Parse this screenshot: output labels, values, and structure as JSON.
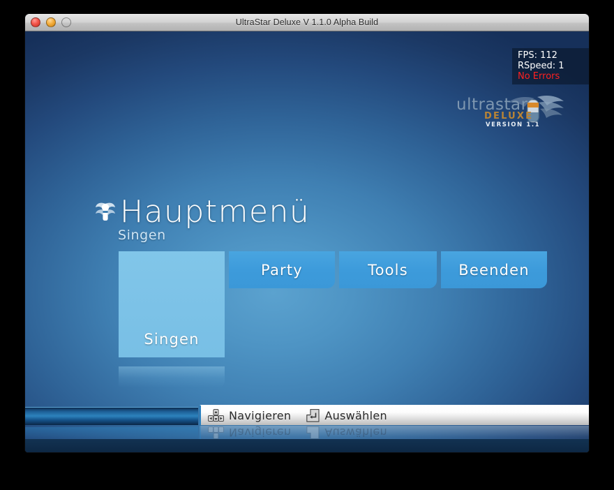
{
  "window": {
    "title": "UltraStar Deluxe V 1.1.0 Alpha Build",
    "controls": {
      "close": "close-button",
      "minimize": "minimize-button",
      "zoom": "zoom-button"
    }
  },
  "overlay": {
    "fps": "FPS: 112",
    "rspeed": "RSpeed: 1",
    "errors": "No Errors",
    "error_color": "#ff2020"
  },
  "logo": {
    "wordmark": "ultrastar",
    "deluxe": "DELUXE",
    "version": "VERSION 1.1"
  },
  "header": {
    "title": "Hauptmenü",
    "subtitle": "Singen",
    "icon": "winged-microphone-icon"
  },
  "menu": {
    "items": [
      {
        "label": "Singen",
        "selected": true,
        "width_class": "btn-w-sing"
      },
      {
        "label": "Party",
        "selected": false,
        "width_class": "btn-w-party"
      },
      {
        "label": "Tools",
        "selected": false,
        "width_class": "btn-w-tools"
      },
      {
        "label": "Beenden",
        "selected": false,
        "width_class": "btn-w-quit"
      }
    ],
    "selected_color": "#7cc2e7",
    "normal_color": "#3d9bdb"
  },
  "statusbar": {
    "items": [
      {
        "icon": "dpad-icon",
        "label": "Navigieren"
      },
      {
        "icon": "enter-key-icon",
        "label": "Auswählen"
      }
    ]
  },
  "theme": {
    "background_center": "#5ba2cf",
    "background_edge": "#16305a",
    "desktop": "#000000"
  }
}
